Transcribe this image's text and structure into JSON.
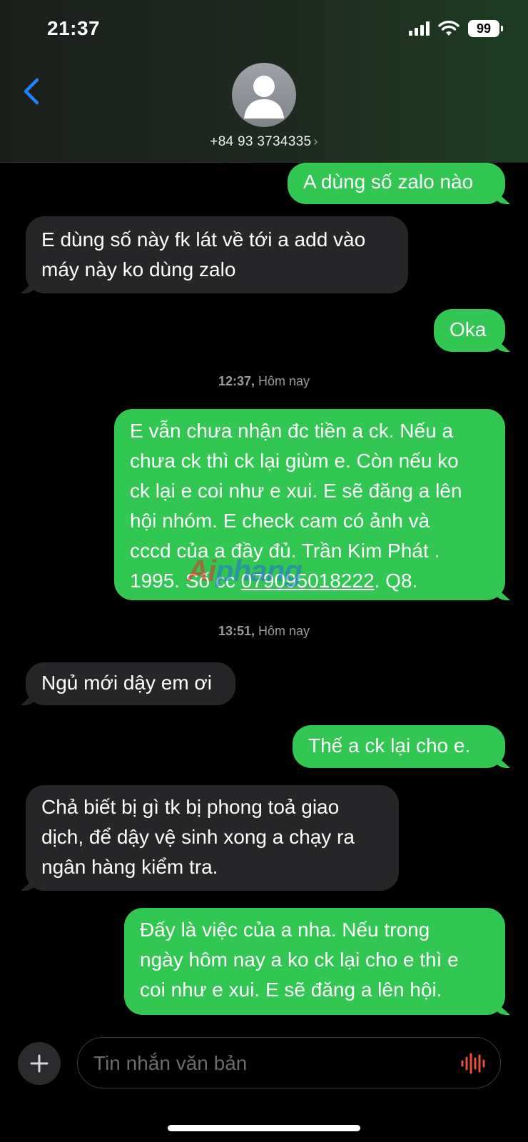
{
  "status_bar": {
    "time": "21:37",
    "battery": "99"
  },
  "header": {
    "phone_number": "+84 93 3734335",
    "chevron": "›"
  },
  "messages": [
    {
      "from": "out",
      "lines": [
        "A dùng số zalo nào"
      ]
    },
    {
      "from": "in",
      "lines": [
        "E dùng số này fk lát về tới a add vào",
        "máy này ko dùng zalo"
      ]
    },
    {
      "from": "out",
      "lines": [
        "Oka"
      ]
    },
    {
      "type": "timestamp",
      "time": "12:37,",
      "label": " Hôm nay"
    },
    {
      "from": "out",
      "lines": [
        "E vẫn chưa nhận đc tiền a ck. Nếu a",
        "chưa ck thì ck lại giùm e. Còn nếu ko",
        "ck lại e coi như e xui. E sẽ đăng a lên",
        "hội nhóm. E check cam có ảnh và",
        "cccd của a đầy đủ. Trần Kim Phát .",
        "1995. Số cc ",
        "079095018222",
        ". Q8."
      ]
    },
    {
      "type": "timestamp",
      "time": "13:51,",
      "label": " Hôm nay"
    },
    {
      "from": "in",
      "lines": [
        "Ngủ mới dậy em ơi"
      ]
    },
    {
      "from": "out",
      "lines": [
        "Thế a ck lại cho e."
      ]
    },
    {
      "from": "in",
      "lines": [
        "Chả biết bị gì tk bị phong toả giao",
        "dịch, để dậy vệ sinh xong a chạy ra",
        "ngân hàng kiểm tra."
      ]
    },
    {
      "from": "out",
      "lines": [
        "Đấy là việc của a nha. Nếu trong",
        "ngày hôm nay a ko ck lại cho e thì e",
        "coi như e xui. E sẽ đăng a lên hội."
      ]
    }
  ],
  "watermark": {
    "part1": "Ai",
    "part2": "phang"
  },
  "composer": {
    "placeholder": "Tin nhắn văn bản"
  },
  "colors": {
    "outgoing": "#31c752",
    "incoming": "#262629",
    "accent": "#1a84ff",
    "voice": "#e8513e"
  },
  "icons": [
    "back-chevron-icon",
    "contact-avatar-icon",
    "plus-icon",
    "voice-waveform-icon",
    "signal-icon",
    "wifi-icon",
    "battery-icon"
  ]
}
